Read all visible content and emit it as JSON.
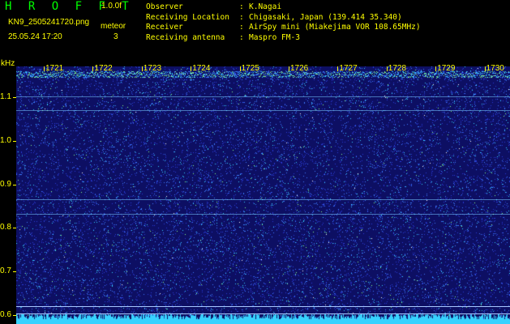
{
  "header": {
    "app_title": "H R O F F T",
    "version": "1.0.0f",
    "filename": "KN9_2505241720.png",
    "datetime": "25.05.24 17:20",
    "meteor_label": "meteor",
    "meteor_count": "3"
  },
  "info": [
    {
      "key": "Observer",
      "sep": ":",
      "value": "K.Nagai"
    },
    {
      "key": "Receiving Location",
      "sep": ":",
      "value": "Chigasaki, Japan (139.414 35.340)"
    },
    {
      "key": "Receiver",
      "sep": ":",
      "value": "AirSpy mini (Miakejima VOR 108.65MHz)"
    },
    {
      "key": "Receiving antenna",
      "sep": ":",
      "value": "Maspro FM-3"
    }
  ],
  "spectrogram": {
    "unit_label": "kHz",
    "time_ticks": [
      "1721",
      "1722",
      "1723",
      "1724",
      "1725",
      "1726",
      "1727",
      "1728",
      "1729",
      "1730"
    ],
    "freq_ticks": [
      "1.1",
      "1.0",
      "0.9",
      "0.8",
      "0.7",
      "0.6"
    ],
    "freq_range_khz": [
      0.58,
      1.17
    ],
    "background_color": "#0d0f63",
    "noise_colors": [
      "#2a3bd6",
      "#3d7cff",
      "#37d2ff",
      "#8cff8c",
      "#ffffff"
    ],
    "accent_color": "#ffff00",
    "carrier_lines_khz": [
      1.102,
      1.07,
      0.866,
      0.832,
      0.62,
      0.605
    ]
  }
}
